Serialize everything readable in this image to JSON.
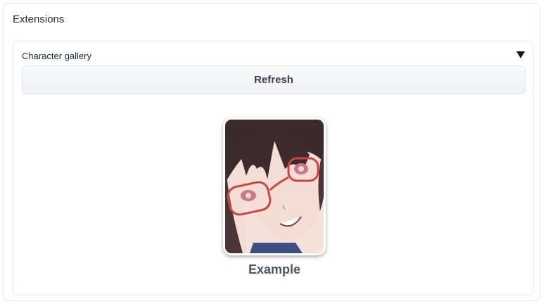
{
  "panel": {
    "title": "Extensions"
  },
  "accordion": {
    "label": "Character gallery",
    "toggle_icon": "caret-down-icon"
  },
  "refresh_button": {
    "label": "Refresh"
  },
  "gallery": {
    "items": [
      {
        "name": "Example",
        "image": "anime-girl-with-red-glasses-portrait"
      }
    ]
  },
  "colors": {
    "border": "#e5e7eb",
    "button_bg": "#f3f4f6",
    "text": "#1f2937"
  }
}
